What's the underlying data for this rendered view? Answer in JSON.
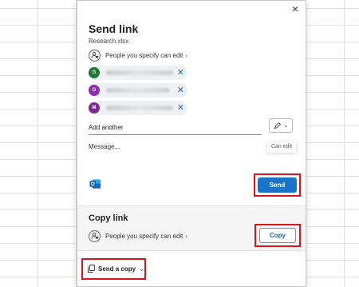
{
  "dialog": {
    "title": "Send link",
    "filename": "Research.xlsx",
    "close_glyph": "×"
  },
  "send_section": {
    "permission_label": "People you specify can edit",
    "permission_chevron": "›",
    "recipients": [
      {
        "initial": "G",
        "color": "#1e7a33"
      },
      {
        "initial": "G",
        "color": "#8e2fae"
      },
      {
        "initial": "M",
        "color": "#7a2b8f"
      }
    ],
    "remove_glyph": "✕",
    "add_placeholder": "Add another",
    "edit_icon": "pencil-icon",
    "edit_dropdown_glyph": "⌄",
    "edit_tooltip": "Can edit",
    "message_placeholder": "Message...",
    "send_label": "Send"
  },
  "copy_section": {
    "title": "Copy link",
    "permission_label": "People you specify can edit",
    "permission_chevron": "›",
    "copy_label": "Copy"
  },
  "footer": {
    "send_copy_label": "Send a copy",
    "send_copy_chevron": "⌄"
  },
  "colors": {
    "accent": "#1a73c8",
    "highlight": "#d9141b",
    "outlook_blue": "#0f6cbd"
  }
}
